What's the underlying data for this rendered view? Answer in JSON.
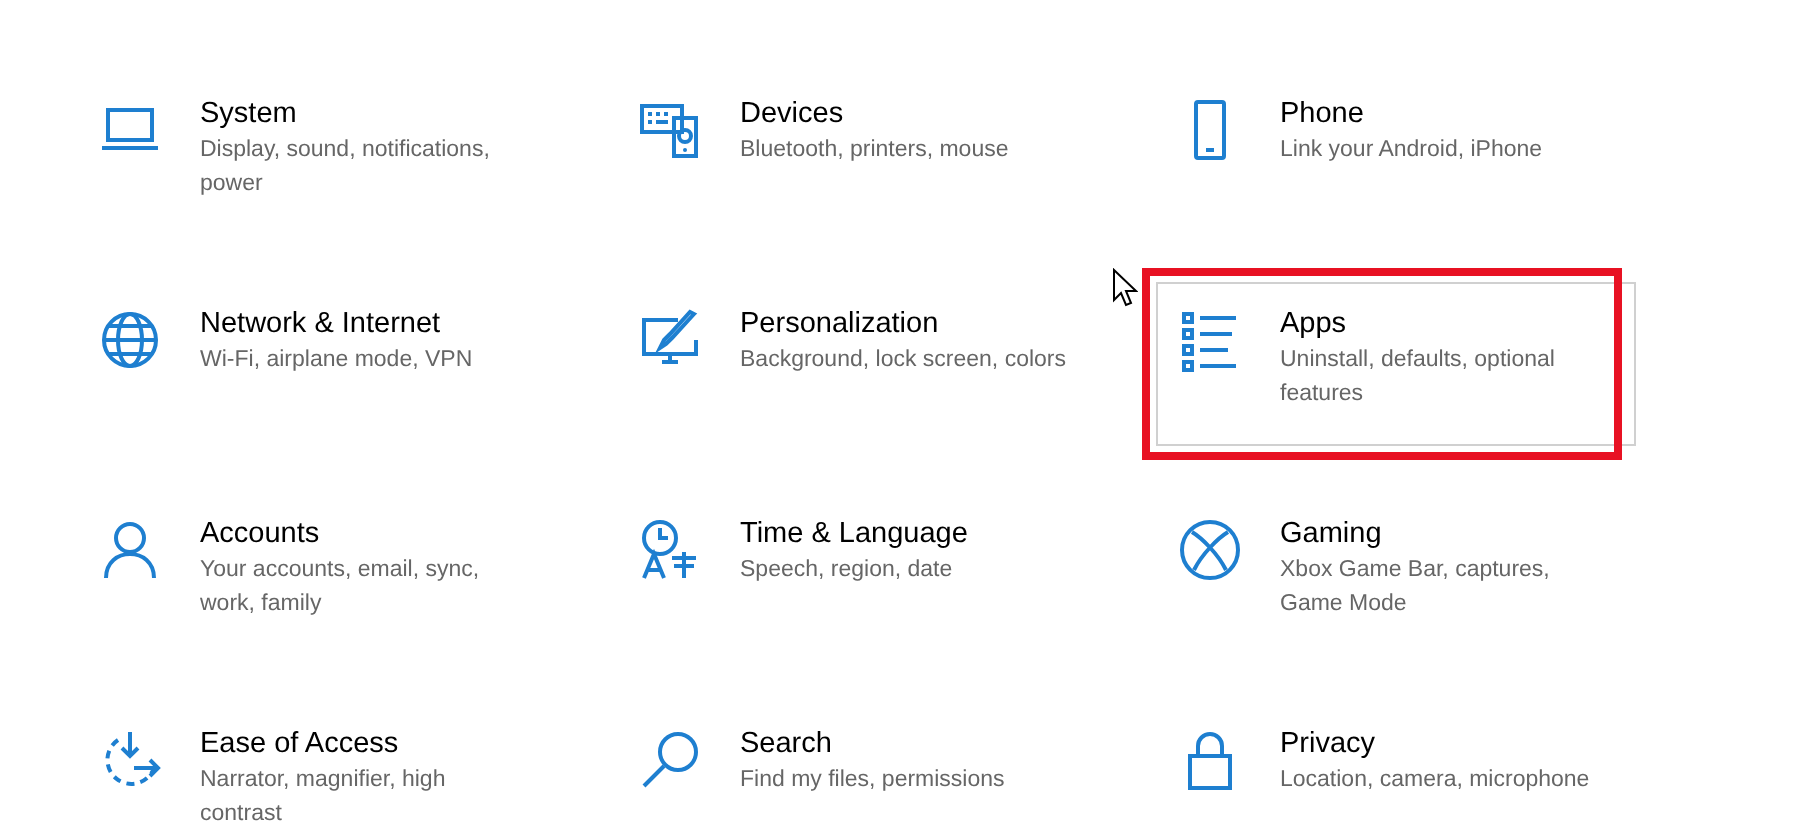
{
  "categories": [
    {
      "title": "System",
      "description": "Display, sound, notifications, power",
      "highlighted": false
    },
    {
      "title": "Devices",
      "description": "Bluetooth, printers, mouse",
      "highlighted": false
    },
    {
      "title": "Phone",
      "description": "Link your Android, iPhone",
      "highlighted": false
    },
    {
      "title": "Network & Internet",
      "description": "Wi-Fi, airplane mode, VPN",
      "highlighted": false
    },
    {
      "title": "Personalization",
      "description": "Background, lock screen, colors",
      "highlighted": false
    },
    {
      "title": "Apps",
      "description": "Uninstall, defaults, optional features",
      "highlighted": true
    },
    {
      "title": "Accounts",
      "description": "Your accounts, email, sync, work, family",
      "highlighted": false
    },
    {
      "title": "Time & Language",
      "description": "Speech, region, date",
      "highlighted": false
    },
    {
      "title": "Gaming",
      "description": "Xbox Game Bar, captures, Game Mode",
      "highlighted": false
    },
    {
      "title": "Ease of Access",
      "description": "Narrator, magnifier, high contrast",
      "highlighted": false
    },
    {
      "title": "Search",
      "description": "Find my files, permissions",
      "highlighted": false
    },
    {
      "title": "Privacy",
      "description": "Location, camera, microphone",
      "highlighted": false
    }
  ]
}
